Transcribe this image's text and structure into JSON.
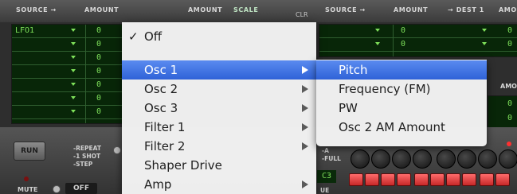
{
  "header": {
    "source_a": "SOURCE →",
    "amount_a": "AMOUNT",
    "dest_a": "→ DEST",
    "amount_b": "AMOUNT",
    "scale": "SCALE",
    "clr": "CLR",
    "source_b": "SOURCE →",
    "amount_c": "AMOUNT",
    "dest_b": "→ DEST 1",
    "amou": "AMOU"
  },
  "left_grid": {
    "rows": [
      {
        "source": "LFO1",
        "amount": "0"
      },
      {
        "source": "",
        "amount": "0"
      },
      {
        "source": "",
        "amount": "0"
      },
      {
        "source": "",
        "amount": "0"
      },
      {
        "source": "",
        "amount": "0"
      },
      {
        "source": "",
        "amount": "0"
      },
      {
        "source": "",
        "amount": "0"
      }
    ]
  },
  "right_grid": {
    "rows": [
      {
        "amount": "0",
        "amount2": "0"
      },
      {
        "amount": "0",
        "amount2": "0"
      }
    ],
    "side_label": "AMOU"
  },
  "lower_panel": {
    "run_label": "RUN",
    "repeat": "-REPEAT",
    "one_shot": "-1 SHOT",
    "step": "-STEP",
    "mute_label": "MUTE",
    "off_label": "OFF",
    "full_a": "-A",
    "full_b": "-FULL",
    "lcd_value": "C3",
    "ue_label": "UE"
  },
  "main_menu": {
    "items": [
      {
        "label": "Off",
        "checked": true,
        "submenu": false
      },
      {
        "label": "Osc 1",
        "submenu": true,
        "selected": true
      },
      {
        "label": "Osc 2",
        "submenu": true
      },
      {
        "label": "Osc 3",
        "submenu": true
      },
      {
        "label": "Filter 1",
        "submenu": true
      },
      {
        "label": "Filter 2",
        "submenu": true
      },
      {
        "label": "Shaper Drive",
        "submenu": false
      },
      {
        "label": "Amp",
        "submenu": true
      }
    ],
    "check_glyph": "✓"
  },
  "sub_menu": {
    "items": [
      {
        "label": "Pitch",
        "selected": true
      },
      {
        "label": "Frequency (FM)"
      },
      {
        "label": "PW"
      },
      {
        "label": "Osc 2 AM Amount"
      }
    ]
  },
  "colors": {
    "lcd_text": "#7ee15a",
    "menu_highlight": "#3b6fe0",
    "pad_red": "#e53935"
  }
}
